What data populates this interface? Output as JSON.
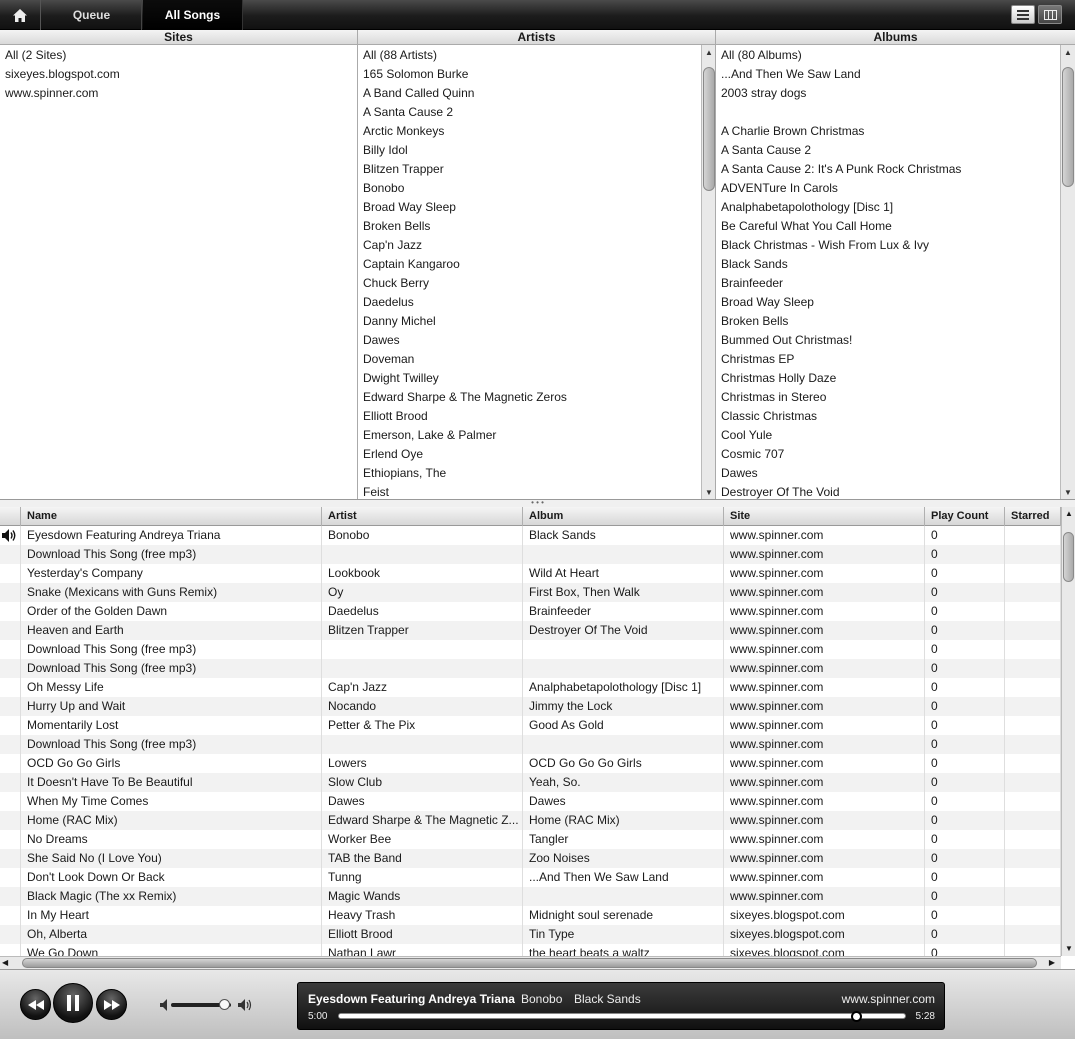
{
  "tabs": {
    "queue": "Queue",
    "all_songs": "All Songs"
  },
  "panes": {
    "sites": {
      "title": "Sites",
      "items": [
        "All (2 Sites)",
        "sixeyes.blogspot.com",
        "www.spinner.com"
      ]
    },
    "artists": {
      "title": "Artists",
      "items": [
        "All (88 Artists)",
        "165 Solomon Burke",
        "A Band Called Quinn",
        "A Santa Cause 2",
        "Arctic Monkeys",
        "Billy Idol",
        "Blitzen Trapper",
        "Bonobo",
        "Broad Way Sleep",
        "Broken Bells",
        "Cap'n Jazz",
        "Captain Kangaroo",
        "Chuck Berry",
        "Daedelus",
        "Danny Michel",
        "Dawes",
        "Doveman",
        "Dwight Twilley",
        "Edward Sharpe & The Magnetic Zeros",
        "Elliott Brood",
        "Emerson, Lake & Palmer",
        "Erlend Oye",
        "Ethiopians, The",
        "Feist"
      ]
    },
    "albums": {
      "title": "Albums",
      "items": [
        "All (80 Albums)",
        "...And Then We Saw Land",
        "2003 stray dogs",
        "",
        "A Charlie Brown Christmas",
        "A Santa Cause 2",
        "A Santa Cause 2: It's A Punk Rock Christmas",
        "ADVENTure In Carols",
        "Analphabetapolothology [Disc 1]",
        "Be Careful What You Call Home",
        "Black Christmas - Wish From Lux & Ivy",
        "Black Sands",
        "Brainfeeder",
        "Broad Way Sleep",
        "Broken Bells",
        "Bummed Out Christmas!",
        "Christmas EP",
        "Christmas Holly Daze",
        "Christmas in Stereo",
        "Classic Christmas",
        "Cool Yule",
        "Cosmic 707",
        "Dawes",
        "Destroyer Of The Void"
      ]
    }
  },
  "table": {
    "columns": [
      "Name",
      "Artist",
      "Album",
      "Site",
      "Play Count",
      "Starred"
    ],
    "rows": [
      [
        "Eyesdown Featuring Andreya Triana",
        "Bonobo",
        "Black Sands",
        "www.spinner.com",
        "0"
      ],
      [
        "Download This Song (free mp3)",
        "",
        "",
        "www.spinner.com",
        "0"
      ],
      [
        "Yesterday's Company",
        "Lookbook",
        "Wild At Heart",
        "www.spinner.com",
        "0"
      ],
      [
        "Snake (Mexicans with Guns Remix)",
        "Oy",
        "First Box, Then Walk",
        "www.spinner.com",
        "0"
      ],
      [
        "Order of the Golden Dawn",
        "Daedelus",
        "Brainfeeder",
        "www.spinner.com",
        "0"
      ],
      [
        "Heaven and Earth",
        "Blitzen Trapper",
        "Destroyer Of The Void",
        "www.spinner.com",
        "0"
      ],
      [
        "Download This Song (free mp3)",
        "",
        "",
        "www.spinner.com",
        "0"
      ],
      [
        "Download This Song (free mp3)",
        "",
        "",
        "www.spinner.com",
        "0"
      ],
      [
        "Oh Messy Life",
        "Cap'n Jazz",
        "Analphabetapolothology [Disc 1]",
        "www.spinner.com",
        "0"
      ],
      [
        "Hurry Up and Wait",
        "Nocando",
        "Jimmy the Lock",
        "www.spinner.com",
        "0"
      ],
      [
        "Momentarily Lost",
        "Petter & The Pix",
        "Good As Gold",
        "www.spinner.com",
        "0"
      ],
      [
        "Download This Song (free mp3)",
        "",
        "",
        "www.spinner.com",
        "0"
      ],
      [
        "OCD Go Go Girls",
        "Lowers",
        "OCD Go Go Go Girls",
        "www.spinner.com",
        "0"
      ],
      [
        "It Doesn't Have To Be Beautiful",
        "Slow Club",
        "Yeah, So.",
        "www.spinner.com",
        "0"
      ],
      [
        "When My Time Comes",
        "Dawes",
        "Dawes",
        "www.spinner.com",
        "0"
      ],
      [
        "Home (RAC Mix)",
        "Edward Sharpe & The Magnetic Z...",
        "Home (RAC Mix)",
        "www.spinner.com",
        "0"
      ],
      [
        "No Dreams",
        "Worker Bee",
        "Tangler",
        "www.spinner.com",
        "0"
      ],
      [
        "She Said No (I Love You)",
        "TAB the Band",
        "Zoo Noises",
        "www.spinner.com",
        "0"
      ],
      [
        "Don't Look Down Or Back",
        "Tunng",
        "...And Then We Saw Land",
        "www.spinner.com",
        "0"
      ],
      [
        "Black Magic (The xx Remix)",
        "Magic Wands",
        "",
        "www.spinner.com",
        "0"
      ],
      [
        "In My Heart",
        "Heavy Trash",
        "Midnight soul serenade",
        "sixeyes.blogspot.com",
        "0"
      ],
      [
        "Oh, Alberta",
        "Elliott Brood",
        "Tin Type",
        "sixeyes.blogspot.com",
        "0"
      ],
      [
        "We Go Down",
        "Nathan Lawr",
        "the heart beats a waltz",
        "sixeyes.blogspot.com",
        "0"
      ]
    ],
    "playing_row": 0
  },
  "player": {
    "title": "Eyesdown Featuring Andreya Triana",
    "artist": "Bonobo",
    "album": "Black Sands",
    "site": "www.spinner.com",
    "elapsed": "5:00",
    "total": "5:28",
    "progress": 0.915,
    "volume": 0.88
  },
  "icons": {
    "home": "home-icon",
    "list_view": "list-view-icon",
    "column_view": "column-view-icon",
    "now_playing": "speaker-icon",
    "prev": "rewind-icon",
    "play_pause": "pause-icon",
    "next": "fast-forward-icon",
    "volume_low": "volume-low-icon",
    "volume_high": "volume-high-icon"
  }
}
